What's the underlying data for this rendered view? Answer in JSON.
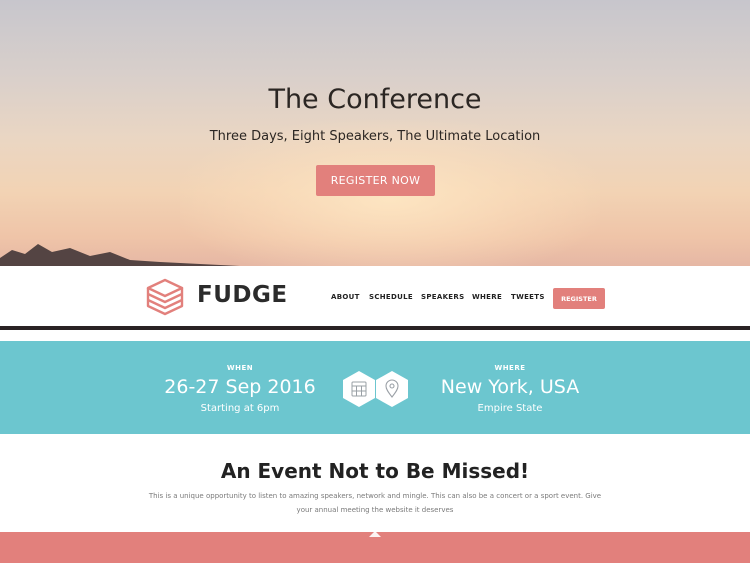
{
  "hero": {
    "title": "The Conference",
    "subtitle": "Three Days, Eight Speakers, The Ultimate Location",
    "button_label": "REGISTER NOW"
  },
  "navbar": {
    "logo_text": "FUDGE",
    "items": [
      "ABOUT",
      "SCHEDULE",
      "SPEAKERS",
      "WHERE",
      "TWEETS"
    ],
    "register_label": "REGISTER"
  },
  "info": {
    "when_label": "WHEN",
    "when_date": "26-27 Sep 2016",
    "when_sub": "Starting at 6pm",
    "where_label": "WHERE",
    "where_place": "New York, USA",
    "where_sub": "Empire State",
    "icons": [
      "calendar-icon",
      "map-pin-icon"
    ]
  },
  "intro": {
    "title": "An Event Not to Be Missed!",
    "text": "This is a unique opportunity to listen to amazing speakers, network and mingle. This can also be a concert or a sport event. Give your annual meeting the website it deserves"
  },
  "colors": {
    "accent": "#e2807c",
    "teal": "#6cc6cf"
  }
}
